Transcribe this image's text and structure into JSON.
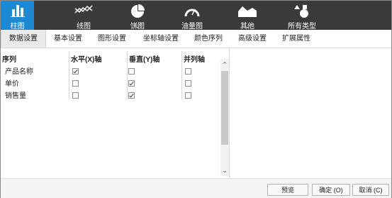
{
  "toolbar": {
    "items": [
      {
        "label": "柱图",
        "icon": "bar-chart-icon"
      },
      {
        "label": "线图",
        "icon": "line-chart-icon"
      },
      {
        "label": "饼图",
        "icon": "pie-chart-icon"
      },
      {
        "label": "油量图",
        "icon": "gauge-icon"
      },
      {
        "label": "其他",
        "icon": "area-chart-icon"
      },
      {
        "label": "所有类型",
        "icon": "all-types-icon"
      }
    ]
  },
  "tabs": [
    "数据设置",
    "基本设置",
    "图形设置",
    "坐标轴设置",
    "颜色序列",
    "高级设置",
    "扩展属性"
  ],
  "grid": {
    "headers": [
      "序列",
      "水平(X)轴",
      "垂直(Y)轴",
      "并列轴"
    ],
    "rows": [
      {
        "name": "产品名称",
        "x": true,
        "y": false,
        "p": false
      },
      {
        "name": "单价",
        "x": false,
        "y": true,
        "p": false
      },
      {
        "name": "销售量",
        "x": false,
        "y": true,
        "p": false
      }
    ]
  },
  "footer": {
    "preview": "预览",
    "ok": "确定 (O)",
    "cancel": "取消 (C)"
  },
  "colors": {
    "toolbar_bg": "#3a3a3a",
    "active_blue": "#1e88d2"
  }
}
